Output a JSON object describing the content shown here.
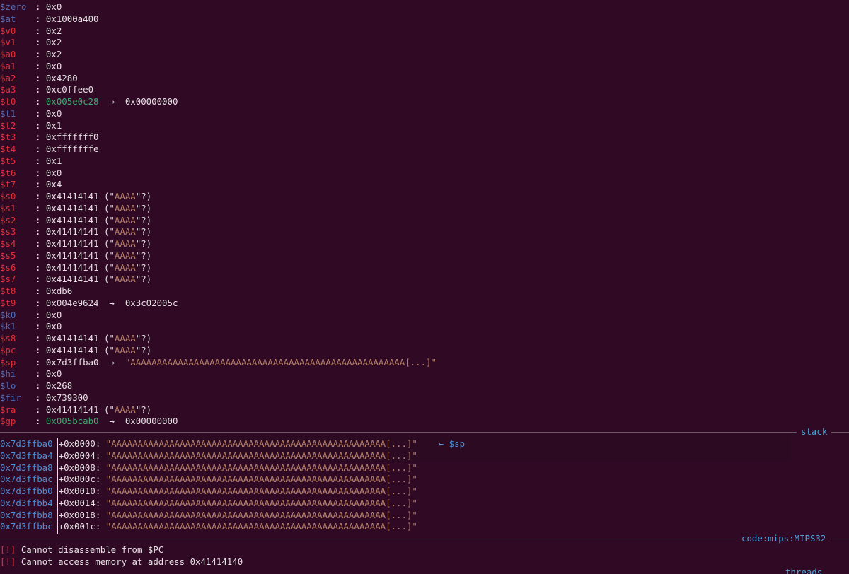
{
  "registers": [
    {
      "name": "$zero",
      "changed": false,
      "value": ": 0x0"
    },
    {
      "name": "$at",
      "changed": false,
      "value": ": 0x1000a400"
    },
    {
      "name": "$v0",
      "changed": true,
      "value": ": 0x2"
    },
    {
      "name": "$v1",
      "changed": true,
      "value": ": 0x2"
    },
    {
      "name": "$a0",
      "changed": true,
      "value": ": 0x2"
    },
    {
      "name": "$a1",
      "changed": true,
      "value": ": 0x0"
    },
    {
      "name": "$a2",
      "changed": true,
      "value": ": 0x4280"
    },
    {
      "name": "$a3",
      "changed": true,
      "value": ": 0xc0ffee0"
    },
    {
      "name": "$t0",
      "changed": true,
      "value": ": ",
      "ptr": "0x005e0c28",
      "arrow": "  →  ",
      "target": "0x00000000"
    },
    {
      "name": "$t1",
      "changed": false,
      "value": ": 0x0"
    },
    {
      "name": "$t2",
      "changed": true,
      "value": ": 0x1"
    },
    {
      "name": "$t3",
      "changed": true,
      "value": ": 0xfffffff0"
    },
    {
      "name": "$t4",
      "changed": true,
      "value": ": 0xfffffffe"
    },
    {
      "name": "$t5",
      "changed": true,
      "value": ": 0x1"
    },
    {
      "name": "$t6",
      "changed": true,
      "value": ": 0x0"
    },
    {
      "name": "$t7",
      "changed": true,
      "value": ": 0x4"
    },
    {
      "name": "$s0",
      "changed": true,
      "value": ": 0x41414141 (\"",
      "str": "AAAA",
      "tail": "\"?)"
    },
    {
      "name": "$s1",
      "changed": true,
      "value": ": 0x41414141 (\"",
      "str": "AAAA",
      "tail": "\"?)"
    },
    {
      "name": "$s2",
      "changed": true,
      "value": ": 0x41414141 (\"",
      "str": "AAAA",
      "tail": "\"?)"
    },
    {
      "name": "$s3",
      "changed": true,
      "value": ": 0x41414141 (\"",
      "str": "AAAA",
      "tail": "\"?)"
    },
    {
      "name": "$s4",
      "changed": true,
      "value": ": 0x41414141 (\"",
      "str": "AAAA",
      "tail": "\"?)"
    },
    {
      "name": "$s5",
      "changed": true,
      "value": ": 0x41414141 (\"",
      "str": "AAAA",
      "tail": "\"?)"
    },
    {
      "name": "$s6",
      "changed": true,
      "value": ": 0x41414141 (\"",
      "str": "AAAA",
      "tail": "\"?)"
    },
    {
      "name": "$s7",
      "changed": true,
      "value": ": 0x41414141 (\"",
      "str": "AAAA",
      "tail": "\"?)"
    },
    {
      "name": "$t8",
      "changed": true,
      "value": ": 0xdb6"
    },
    {
      "name": "$t9",
      "changed": true,
      "value": ": 0x004e9624  →  0x3c02005c"
    },
    {
      "name": "$k0",
      "changed": false,
      "value": ": 0x0"
    },
    {
      "name": "$k1",
      "changed": false,
      "value": ": 0x0"
    },
    {
      "name": "$s8",
      "changed": true,
      "value": ": 0x41414141 (\"",
      "str": "AAAA",
      "tail": "\"?)"
    },
    {
      "name": "$pc",
      "changed": true,
      "value": ": 0x41414141 (\"",
      "str": "AAAA",
      "tail": "\"?)"
    },
    {
      "name": "$sp",
      "changed": true,
      "value": ": 0x7d3ffba0  →  ",
      "str": "\"AAAAAAAAAAAAAAAAAAAAAAAAAAAAAAAAAAAAAAAAAAAAAAAAAAAA[...]\"",
      "tail": ""
    },
    {
      "name": "$hi",
      "changed": false,
      "value": ": 0x0"
    },
    {
      "name": "$lo",
      "changed": false,
      "value": ": 0x268"
    },
    {
      "name": "$fir",
      "changed": false,
      "value": ": 0x739300"
    },
    {
      "name": "$ra",
      "changed": true,
      "value": ": 0x41414141 (\"",
      "str": "AAAA",
      "tail": "\"?)"
    },
    {
      "name": "$gp",
      "changed": true,
      "value": ": ",
      "ptr": "0x005bcab0",
      "arrow": "  →  ",
      "target": "0x00000000"
    }
  ],
  "sections": {
    "stack": "stack",
    "code": "code:mips:MIPS32",
    "threads": "threads"
  },
  "stack": [
    {
      "addr": "0x7d3ffba0",
      "offset": "+0x0000:",
      "str": "\"AAAAAAAAAAAAAAAAAAAAAAAAAAAAAAAAAAAAAAAAAAAAAAAAAAAA[...]\"",
      "note": "← $sp"
    },
    {
      "addr": "0x7d3ffba4",
      "offset": "+0x0004:",
      "str": "\"AAAAAAAAAAAAAAAAAAAAAAAAAAAAAAAAAAAAAAAAAAAAAAAAAAAA[...]\"",
      "note": ""
    },
    {
      "addr": "0x7d3ffba8",
      "offset": "+0x0008:",
      "str": "\"AAAAAAAAAAAAAAAAAAAAAAAAAAAAAAAAAAAAAAAAAAAAAAAAAAAA[...]\"",
      "note": ""
    },
    {
      "addr": "0x7d3ffbac",
      "offset": "+0x000c:",
      "str": "\"AAAAAAAAAAAAAAAAAAAAAAAAAAAAAAAAAAAAAAAAAAAAAAAAAAAA[...]\"",
      "note": ""
    },
    {
      "addr": "0x7d3ffbb0",
      "offset": "+0x0010:",
      "str": "\"AAAAAAAAAAAAAAAAAAAAAAAAAAAAAAAAAAAAAAAAAAAAAAAAAAAA[...]\"",
      "note": ""
    },
    {
      "addr": "0x7d3ffbb4",
      "offset": "+0x0014:",
      "str": "\"AAAAAAAAAAAAAAAAAAAAAAAAAAAAAAAAAAAAAAAAAAAAAAAAAAAA[...]\"",
      "note": ""
    },
    {
      "addr": "0x7d3ffbb8",
      "offset": "+0x0018:",
      "str": "\"AAAAAAAAAAAAAAAAAAAAAAAAAAAAAAAAAAAAAAAAAAAAAAAAAAAA[...]\"",
      "note": ""
    },
    {
      "addr": "0x7d3ffbbc",
      "offset": "+0x001c:",
      "str": "\"AAAAAAAAAAAAAAAAAAAAAAAAAAAAAAAAAAAAAAAAAAAAAAAAAAAA[...]\"",
      "note": ""
    }
  ],
  "errors": [
    {
      "tag": "[!]",
      "text": " Cannot disassemble from $PC"
    },
    {
      "tag": "[!]",
      "text": " Cannot access memory at address 0x41414140"
    }
  ],
  "colors": {
    "background": "#300a24",
    "changed_register": "#e0303a",
    "unchanged_register": "#4e6bb7",
    "string": "#b7826a",
    "pointer": "#3aa86f",
    "section_label": "#4aa3d8"
  }
}
